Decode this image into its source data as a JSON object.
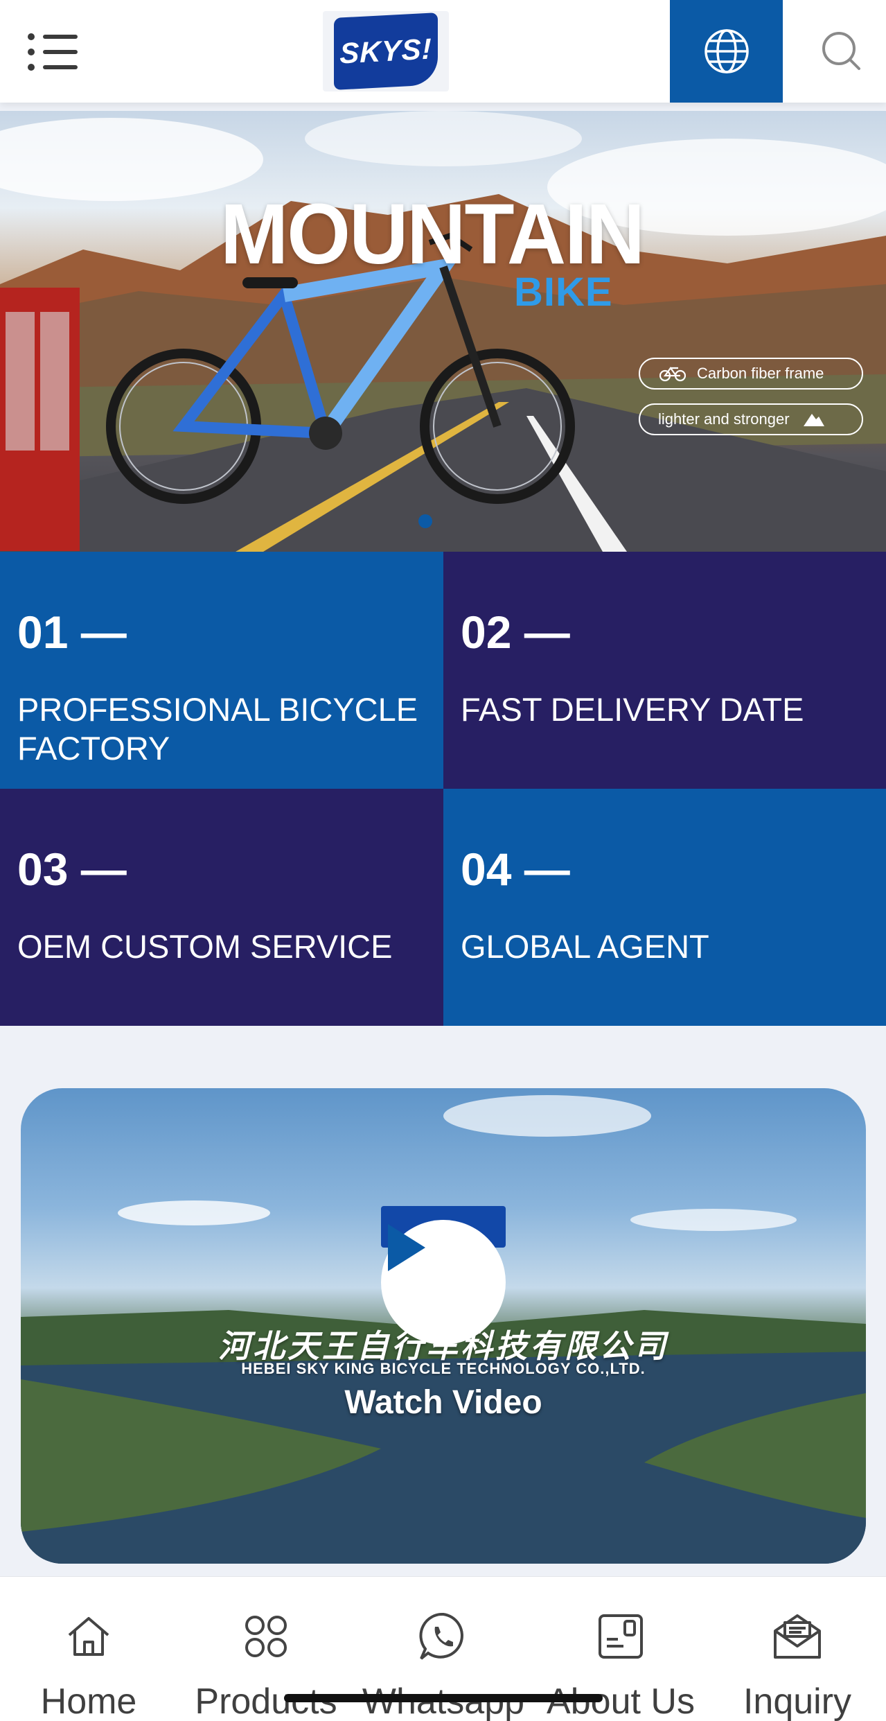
{
  "header": {
    "menu_icon": "list-menu-icon",
    "logo_text": "SKYS!",
    "language_icon": "globe-icon",
    "search_icon": "search-icon",
    "accent_color": "#0b5aa6"
  },
  "banner": {
    "title": "MOUNTAIN",
    "subtitle": "BIKE",
    "tags": [
      {
        "label": "Carbon fiber frame",
        "icon": "bicycle-icon"
      },
      {
        "label": "lighter and stronger",
        "icon": "mountain-icon"
      }
    ]
  },
  "features": [
    {
      "number": "01 —",
      "label": "PROFESSIONAL BICYCLE FACTORY",
      "color": "#0b5aa6"
    },
    {
      "number": "02 —",
      "label": "FAST DELIVERY DATE",
      "color": "#271f63"
    },
    {
      "number": "03 —",
      "label": "OEM CUSTOM SERVICE",
      "color": "#271f63"
    },
    {
      "number": "04 —",
      "label": "GLOBAL AGENT",
      "color": "#0b5aa6"
    }
  ],
  "video": {
    "company_cn": "河北天王自行车科技有限公司",
    "company_en": "HEBEI SKY KING BICYCLE TECHNOLOGY CO.,LTD.",
    "watch_label": "Watch Video",
    "play_icon": "play-icon"
  },
  "bottom_nav": [
    {
      "label": "Home",
      "icon": "home-icon"
    },
    {
      "label": "Products",
      "icon": "products-grid-icon"
    },
    {
      "label": "Whatsapp",
      "icon": "whatsapp-icon"
    },
    {
      "label": "About Us",
      "icon": "about-us-icon"
    },
    {
      "label": "Inquiry",
      "icon": "inquiry-mail-icon"
    }
  ]
}
